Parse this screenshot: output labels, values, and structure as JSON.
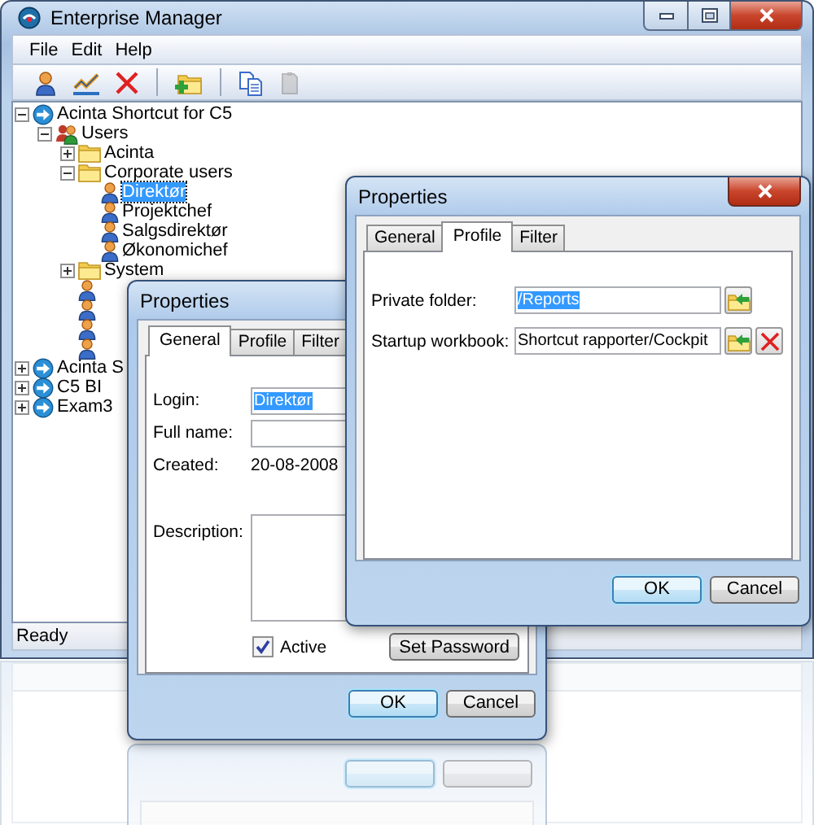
{
  "window": {
    "title": "Enterprise Manager"
  },
  "menu": [
    {
      "label": "File"
    },
    {
      "label": "Edit"
    },
    {
      "label": "Help"
    }
  ],
  "toolbar_groups": [
    {
      "items": [
        {
          "kind": "user",
          "disabled": false
        },
        {
          "kind": "edit",
          "disabled": false
        },
        {
          "kind": "delete",
          "disabled": false
        }
      ]
    },
    {
      "items": [
        {
          "kind": "new-folder",
          "disabled": false
        }
      ]
    },
    {
      "items": [
        {
          "kind": "copy",
          "disabled": false
        },
        {
          "kind": "paste",
          "disabled": true
        }
      ]
    }
  ],
  "tree": [
    {
      "kind": "server",
      "label": "Acinta Shortcut for C5",
      "expanded": true,
      "selected": false,
      "children": [
        {
          "kind": "group",
          "label": "Users",
          "expanded": true,
          "selected": false,
          "children": [
            {
              "kind": "folder",
              "label": "Acinta",
              "expanded": false,
              "selected": false
            },
            {
              "kind": "folder",
              "label": "Corporate users",
              "expanded": true,
              "selected": false,
              "children": [
                {
                  "kind": "user",
                  "label": "Direktør",
                  "selected": true
                },
                {
                  "kind": "user",
                  "label": "Projektchef",
                  "selected": false
                },
                {
                  "kind": "user",
                  "label": "Salgsdirektør",
                  "selected": false
                },
                {
                  "kind": "user",
                  "label": "Økonomichef",
                  "selected": false
                }
              ]
            },
            {
              "kind": "folder",
              "label": "System",
              "expanded": false,
              "selected": false
            },
            {
              "kind": "user"
            },
            {
              "kind": "user"
            },
            {
              "kind": "user"
            },
            {
              "kind": "user"
            }
          ]
        }
      ]
    },
    {
      "kind": "server",
      "label": "Acinta S",
      "expanded": false,
      "selected": false
    },
    {
      "kind": "server",
      "label": "C5 BI",
      "expanded": false,
      "selected": false
    },
    {
      "kind": "server",
      "label": "Exam3",
      "expanded": false,
      "selected": false
    }
  ],
  "status_bar": "Ready",
  "dialogs": [
    {
      "title": "Properties",
      "close_button": false,
      "tabs": [
        {
          "label": "General",
          "selected": true
        },
        {
          "label": "Profile",
          "selected": false
        },
        {
          "label": "Filter",
          "selected": false
        }
      ],
      "rows": [
        {
          "kind": "field",
          "label": "Login:",
          "value": "Direktør",
          "value_selected": true
        },
        {
          "kind": "field",
          "label": "Full name:"
        },
        {
          "kind": "info",
          "label": "Created:",
          "value": "20-08-2008"
        },
        {
          "kind": "textarea",
          "label": "Description:"
        }
      ],
      "checkbox": {
        "label": "Active",
        "checked": true
      },
      "action_button": {
        "label": "Set Password"
      },
      "buttons": [
        {
          "label": "OK",
          "default": true
        },
        {
          "label": "Cancel",
          "default": false
        }
      ]
    },
    {
      "title": "Properties",
      "close_button": true,
      "tabs": [
        {
          "label": "General",
          "selected": false
        },
        {
          "label": "Profile",
          "selected": true
        },
        {
          "label": "Filter",
          "selected": false
        }
      ],
      "rows": [
        {
          "kind": "path",
          "label": "Private folder:",
          "value": "/Reports",
          "value_selected": true,
          "clearable": false
        },
        {
          "kind": "path",
          "label": "Startup workbook:",
          "value": "Shortcut rapporter/Cockpit",
          "value_selected": false,
          "clearable": true
        }
      ],
      "buttons": [
        {
          "label": "OK",
          "default": true
        },
        {
          "label": "Cancel",
          "default": false
        }
      ]
    }
  ]
}
